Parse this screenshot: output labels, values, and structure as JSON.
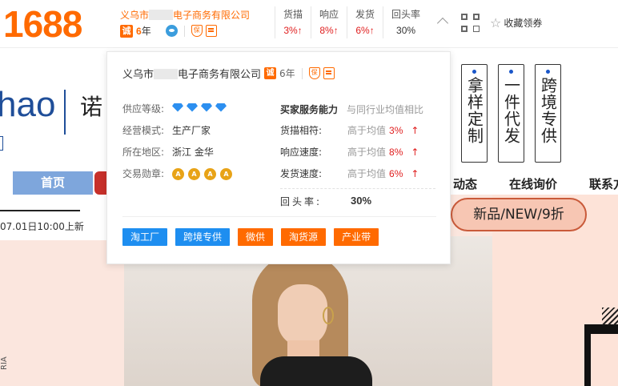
{
  "header": {
    "logo": "1688",
    "company_prefix": "义乌市",
    "company_suffix": "电子商务有限公司",
    "cert_badge": "诚",
    "years_num": "6",
    "years_unit": "年",
    "shield_glyph": "保",
    "metrics": [
      {
        "label": "货描",
        "value": "3%↑"
      },
      {
        "label": "响应",
        "value": "8%↑"
      },
      {
        "label": "发货",
        "value": "6%↑"
      },
      {
        "label": "回头率",
        "value": "30%"
      }
    ],
    "favorite_label": "收藏领券"
  },
  "page": {
    "brand_text": "hao",
    "brand_cn": "诺",
    "nav_home": "首页",
    "nav_items": [
      "动态",
      "在线询价",
      "联系方"
    ],
    "notice": "07.01日10:00上新",
    "vertical_tags": [
      "拿样定制",
      "一件代发",
      "跨境专供"
    ],
    "promo_pill": "新品/NEW/9折",
    "side_text": "RIA"
  },
  "popover": {
    "company_prefix": "义乌市",
    "company_suffix": "电子商务有限公司",
    "years": "6年",
    "left_rows": [
      {
        "label": "供应等级:",
        "value": "",
        "diamonds": 4
      },
      {
        "label": "经营模式:",
        "value": "生产厂家"
      },
      {
        "label": "所在地区:",
        "value": "浙江 金华"
      },
      {
        "label": "交易勋章:",
        "value": "",
        "medals": 4
      }
    ],
    "service_title": "买家服务能力",
    "service_subtitle": "与同行业均值相比",
    "service_rows": [
      {
        "label": "货描相符:",
        "compare": "高于均值",
        "value": "3%",
        "arrow": "↑"
      },
      {
        "label": "响应速度:",
        "compare": "高于均值",
        "value": "8%",
        "arrow": "↑"
      },
      {
        "label": "发货速度:",
        "compare": "高于均值",
        "value": "6%",
        "arrow": "↑"
      }
    ],
    "repeat_label": "回头率:",
    "repeat_value": "30%",
    "tags": [
      {
        "label": "淘工厂",
        "color": "#1e8ef0"
      },
      {
        "label": "跨境专供",
        "color": "#1e8ef0"
      },
      {
        "label": "微供",
        "color": "#ff6a00"
      },
      {
        "label": "淘货源",
        "color": "#ff6a00"
      },
      {
        "label": "产业带",
        "color": "#ff6a00"
      }
    ]
  },
  "colors": {
    "brand_orange": "#ff6a00",
    "up_red": "#e02020",
    "diamond_blue": "#2c8ff0"
  }
}
